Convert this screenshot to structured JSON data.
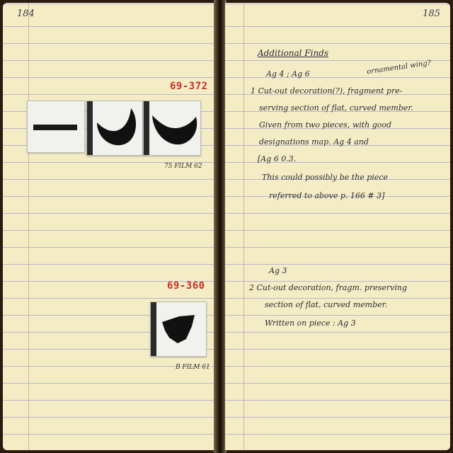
{
  "left_page": {
    "page_number": "184",
    "specimens": [
      {
        "number": "69-372",
        "caption": "75 FILM 62"
      },
      {
        "number": "69-360",
        "caption": "B FILM 61"
      }
    ]
  },
  "right_page": {
    "page_number": "185",
    "heading": "Additional Finds",
    "entry1": {
      "context": "Ag 4 ; Ag 6",
      "note": "ornamental wing?",
      "lines": [
        "1  Cut-out decoration(?), fragment pre-",
        "serving section of flat, curved member.",
        "Given from two pieces, with good",
        "designations map. Ag 4 and",
        "[Ag 6  0.3."
      ],
      "remark": [
        "This could possibly be the piece",
        "referred to above p. 166 # 3]"
      ]
    },
    "entry2": {
      "context": "Ag 3",
      "lines": [
        "2  Cut-out decoration, fragm. preserving",
        "section of flat, curved member.",
        "Written on piece : Ag 3"
      ]
    }
  }
}
